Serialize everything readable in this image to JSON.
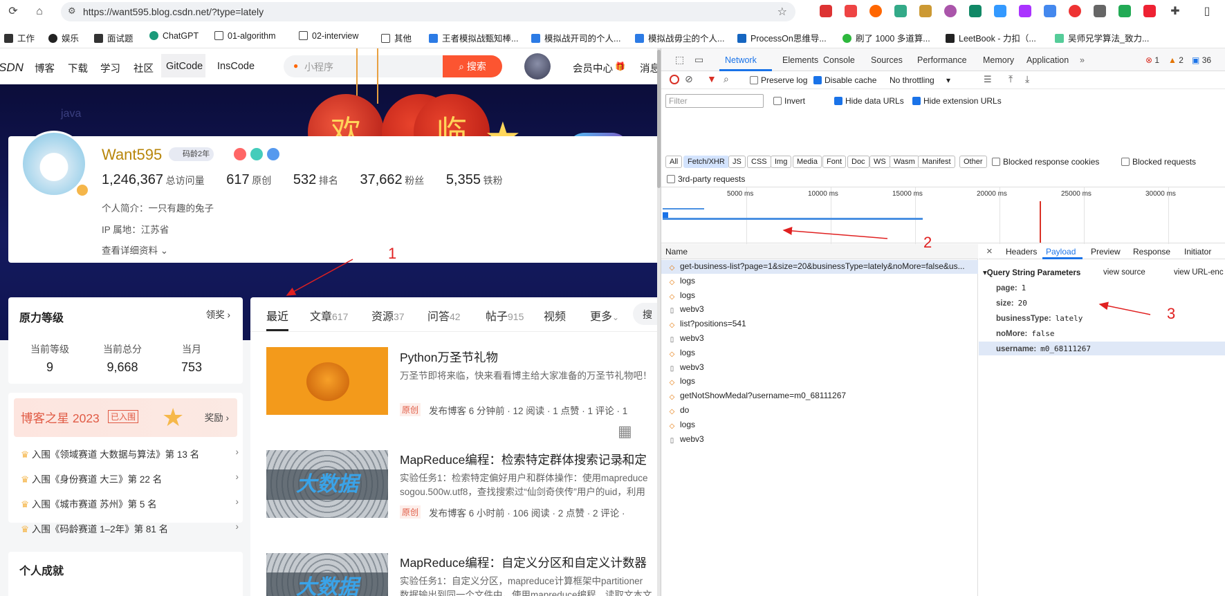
{
  "browser": {
    "url": "https://want595.blog.csdn.net/?type=lately",
    "bookmarks": [
      "工作",
      "娱乐",
      "面试题",
      "ChatGPT",
      "01-algorithm",
      "02-interview",
      "其他",
      "王者模拟战甄知棒...",
      "模拟战开司的个人...",
      "模拟战毋尘的个人...",
      "ProcessOn思维导...",
      "刷了 1000 多道算...",
      "LeetBook - 力扣（...",
      "吴师兄学算法_致力..."
    ]
  },
  "site": {
    "logo": "SDN",
    "nav": [
      "博客",
      "下载",
      "学习",
      "社区",
      "GitCode",
      "InsCode"
    ],
    "search_placeholder": "小程序",
    "search_button": "搜索",
    "member_center": "会员中心",
    "messages": "消息",
    "banner_tag": "java",
    "lantern_chars": [
      "欢",
      "临"
    ]
  },
  "profile": {
    "name": "Want595",
    "badge_years": "码龄2年",
    "stats": [
      {
        "value": "1,246,367",
        "label": "总访问量"
      },
      {
        "value": "617",
        "label": "原创"
      },
      {
        "value": "532",
        "label": "排名"
      },
      {
        "value": "37,662",
        "label": "粉丝"
      },
      {
        "value": "5,355",
        "label": "铁粉"
      }
    ],
    "intro": "个人简介：一只有趣的兔子",
    "ip": "IP 属地：江苏省",
    "more_info": "查看详细资料"
  },
  "level_card": {
    "title": "原力等级",
    "reward": "领奖",
    "items": [
      {
        "label": "当前等级",
        "value": "9"
      },
      {
        "label": "当前总分",
        "value": "9,668"
      },
      {
        "label": "当月",
        "value": "753"
      }
    ]
  },
  "star_card": {
    "title": "博客之星 2023",
    "tag": "已入围",
    "reward": "奖励",
    "entries": [
      "入围《领域赛道 大数据与算法》第 13 名",
      "入围《身份赛道 大三》第 22 名",
      "入围《城市赛道 苏州》第 5 名",
      "入围《码龄赛道 1–2年》第 81 名"
    ]
  },
  "achievements_title": "个人成就",
  "tabs": [
    {
      "label": "最近",
      "count": ""
    },
    {
      "label": "文章",
      "count": "617"
    },
    {
      "label": "资源",
      "count": "37"
    },
    {
      "label": "问答",
      "count": "42"
    },
    {
      "label": "帖子",
      "count": "915"
    },
    {
      "label": "视频",
      "count": ""
    },
    {
      "label": "更多",
      "count": ""
    }
  ],
  "search_short": "搜",
  "articles": [
    {
      "title": "Python万圣节礼物",
      "summary": "万圣节即将来临，快来看看博主给大家准备的万圣节礼物吧！",
      "tag": "原创",
      "meta": "发布博客 6 分钟前 · 12 阅读 · 1 点赞 · 1 评论 · 1"
    },
    {
      "title": "MapReduce编程：检索特定群体搜索记录和定",
      "summary": "实验任务1：检索特定偏好用户和群体操作：使用mapreduce",
      "summary2": "sogou.500w.utf8，查找搜索过“仙剑奇侠传”用户的uid，利用",
      "tag": "原创",
      "meta": "发布博客 6 小时前 · 106 阅读 · 2 点赞 · 2 评论 ·"
    },
    {
      "title": "MapReduce编程：自定义分区和自定义计数器",
      "summary": "实验任务1：自定义分区，mapreduce计算框架中partitioner",
      "summary2": "数据输出到同一个文件中。使用mapreduce编程，读取文本文"
    }
  ],
  "thumb_text": "大数据",
  "devtools": {
    "tabs": [
      "Network",
      "Elements",
      "Console",
      "Sources",
      "Performance",
      "Memory",
      "Application"
    ],
    "errors": "1",
    "warnings": "2",
    "issues": "36",
    "preserve_log": "Preserve log",
    "disable_cache": "Disable cache",
    "throttle": "No throttling",
    "filter_placeholder": "Filter",
    "invert": "Invert",
    "hide_data_urls": "Hide data URLs",
    "hide_ext_urls": "Hide extension URLs",
    "type_chips": [
      "All",
      "Fetch/XHR",
      "JS",
      "CSS",
      "Img",
      "Media",
      "Font",
      "Doc",
      "WS",
      "Wasm",
      "Manifest",
      "Other"
    ],
    "blocked_cookies": "Blocked response cookies",
    "blocked_requests": "Blocked requests",
    "third_party": "3rd-party requests",
    "timeline_ticks": [
      "5000 ms",
      "10000 ms",
      "15000 ms",
      "20000 ms",
      "25000 ms",
      "30000 ms"
    ],
    "name_header": "Name",
    "requests": [
      {
        "name": "get-business-list?page=1&size=20&businessType=lately&noMore=false&us...",
        "type": "xhr"
      },
      {
        "name": "logs",
        "type": "xhr"
      },
      {
        "name": "logs",
        "type": "xhr"
      },
      {
        "name": "webv3",
        "type": "doc"
      },
      {
        "name": "list?positions=541",
        "type": "xhr"
      },
      {
        "name": "webv3",
        "type": "doc"
      },
      {
        "name": "logs",
        "type": "xhr"
      },
      {
        "name": "webv3",
        "type": "doc"
      },
      {
        "name": "logs",
        "type": "xhr"
      },
      {
        "name": "getNotShowMedal?username=m0_68111267",
        "type": "xhr"
      },
      {
        "name": "do",
        "type": "xhr"
      },
      {
        "name": "logs",
        "type": "xhr"
      },
      {
        "name": "webv3",
        "type": "doc"
      }
    ],
    "detail_tabs": [
      "Headers",
      "Payload",
      "Preview",
      "Response",
      "Initiator"
    ],
    "qsp_title": "Query String Parameters",
    "view_source": "view source",
    "view_url": "view URL-enc",
    "params": [
      {
        "key": "page:",
        "value": "1"
      },
      {
        "key": "size:",
        "value": "20"
      },
      {
        "key": "businessType:",
        "value": "lately"
      },
      {
        "key": "noMore:",
        "value": "false"
      },
      {
        "key": "username:",
        "value": "m0_68111267"
      }
    ]
  },
  "annotations": [
    "1",
    "2",
    "3"
  ]
}
